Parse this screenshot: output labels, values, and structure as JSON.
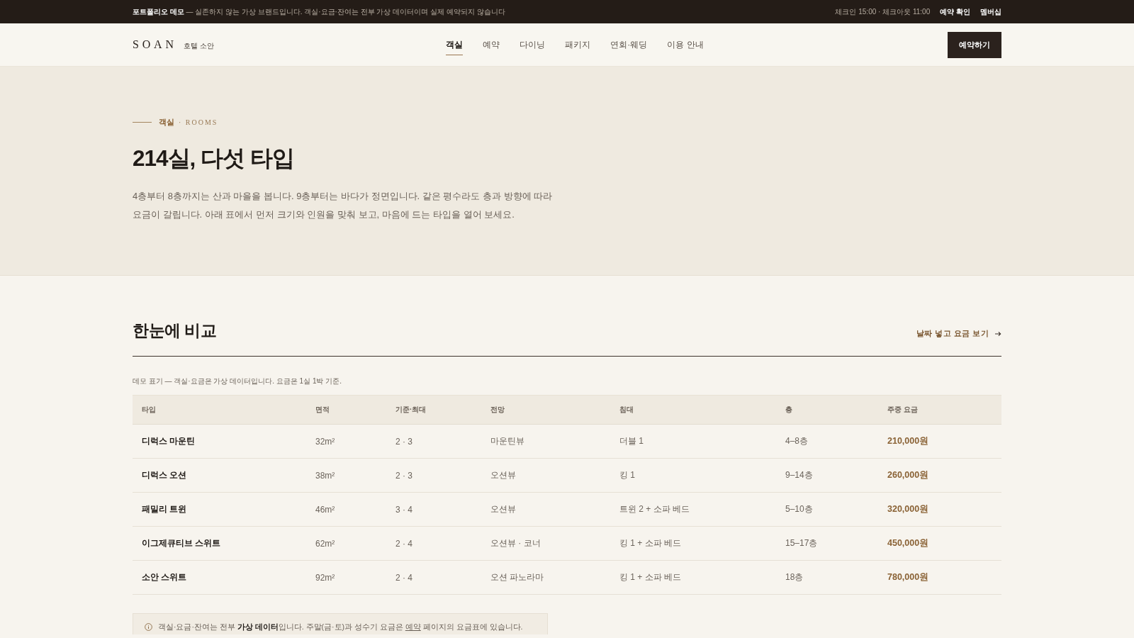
{
  "top_bar": {
    "notice": "**포트폴리오 데모** — 실존하지 않는 가상 브랜드입니다. 객실·요금·잔여는 전부 가상 데이터이며 실제 예약되지 않습니다",
    "hours": "체크인 15:00 · 체크아웃 11:00",
    "links": [
      "예약 확인",
      "멤버십"
    ]
  },
  "header": {
    "logo": "SOAN",
    "logo_sub": "호텔 소안",
    "nav": [
      {
        "label": "객실",
        "selected": true
      },
      {
        "label": "예약",
        "selected": false
      },
      {
        "label": "다이닝",
        "selected": false
      },
      {
        "label": "패키지",
        "selected": false
      },
      {
        "label": "연회·웨딩",
        "selected": false
      },
      {
        "label": "이용 안내",
        "selected": false
      }
    ],
    "cta": "예약하기"
  },
  "hero": {
    "eyebrow": "객실",
    "eyebrow_en": "· ROOMS",
    "title": "214실, 다섯 타입",
    "intro": "4층부터 8층까지는 산과 마을을 봅니다. 9층부터는 바다가 정면입니다. 같은 평수라도 층과 방향에 따라 요금이 갈립니다. 아래 표에서 먼저 크기와 인원을 맞춰 보고, 마음에 드는 타입을 열어 보세요."
  },
  "compare": {
    "title": "한눈에 비교",
    "link": "날짜 넣고 요금 보기",
    "caption": "데모 표기 — 객실·요금은 가상 데이터입니다. 요금은 1실 1박 기준.",
    "table": {
      "columns": [
        "타입",
        "면적",
        "기준·최대",
        "전망",
        "침대",
        "층",
        "주중 요금"
      ],
      "rows": [
        [
          "디럭스 마운틴",
          "32m²",
          "2 · 3",
          "마운틴뷰",
          "더블 1",
          "4–8층",
          "210,000원"
        ],
        [
          "디럭스 오션",
          "38m²",
          "2 · 3",
          "오션뷰",
          "킹 1",
          "9–14층",
          "260,000원"
        ],
        [
          "패밀리 트윈",
          "46m²",
          "3 · 4",
          "오션뷰",
          "트윈 2 + 소파 베드",
          "5–10층",
          "320,000원"
        ],
        [
          "이그제큐티브 스위트",
          "62m²",
          "2 · 4",
          "오션뷰 · 코너",
          "킹 1 + 소파 베드",
          "15–17층",
          "450,000원"
        ],
        [
          "소안 스위트",
          "92m²",
          "2 · 4",
          "오션 파노라마",
          "킹 1 + 소파 베드",
          "18층",
          "780,000원"
        ]
      ]
    },
    "notice": {
      "text_before": "객실·요금·잔여는 전부 **가상 데이터**입니다. 주말(금·토)과 성수기 요금은 ",
      "link": "예약",
      "text_after": " 페이지의 요금표에 있습니다."
    }
  }
}
